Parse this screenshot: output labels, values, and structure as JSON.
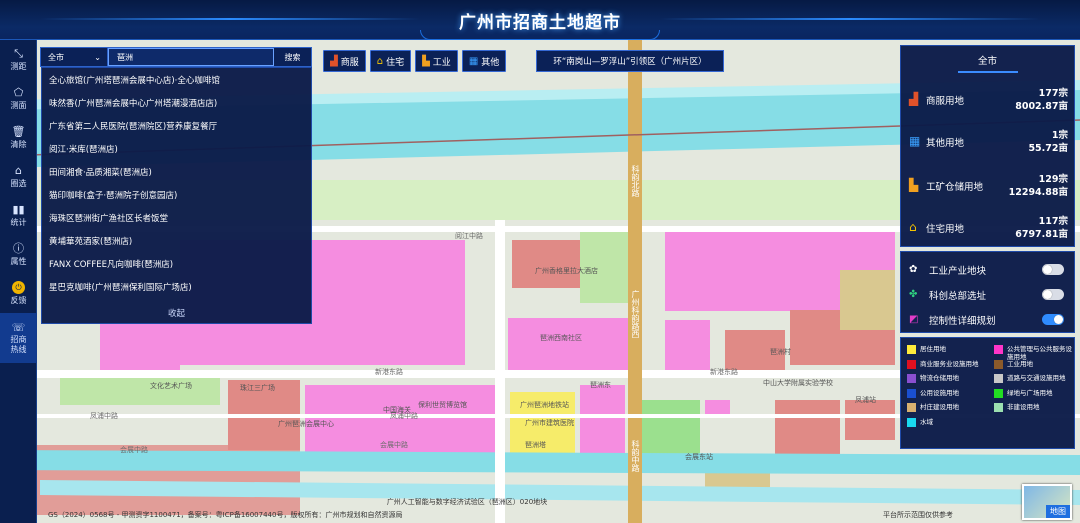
{
  "header": {
    "title": "广州市招商土地超市"
  },
  "toolbar": {
    "items": [
      {
        "label": "测距",
        "icon": "ruler-icon"
      },
      {
        "label": "测面",
        "icon": "polygon-icon"
      },
      {
        "label": "清除",
        "icon": "trash-icon"
      },
      {
        "label": "圈选",
        "icon": "circle-select-icon"
      },
      {
        "label": "统计",
        "icon": "bar-chart-icon"
      },
      {
        "label": "属性",
        "icon": "info-icon"
      },
      {
        "label": "反馈",
        "icon": "feedback-icon"
      },
      {
        "label": "招商热线",
        "icon": "phone-icon"
      }
    ]
  },
  "search": {
    "city": "全市",
    "query": "琶洲",
    "button": "搜索",
    "results": [
      "全心旅馆(广州塔琶洲会展中心店)·全心咖啡馆",
      "味然香(广州琶洲会展中心广州塔潮漫酒店店)",
      "广东省第二人民医院(琶洲院区)营养康复餐厅",
      "阅江·米库(琶洲店)",
      "田间湘食·品质湘菜(琶洲店)",
      "猫印咖啡(盒子·琶洲院子创意园店)",
      "海珠区琶洲街广渔社区长者饭堂",
      "黄埔華苑酒家(琶洲店)",
      "FANX COFFEE凡向咖啡(琶洲店)",
      "星巴克咖啡(广州琶洲保利国际广场店)"
    ],
    "collapse": "收起"
  },
  "categories": [
    {
      "label": "商服",
      "icon": "commerce-icon"
    },
    {
      "label": "住宅",
      "icon": "house-icon"
    },
    {
      "label": "工业",
      "icon": "factory-icon"
    },
    {
      "label": "其他",
      "icon": "other-icon"
    }
  ],
  "ring_button": "环“南岗山—罗浮山”引领区（广州片区）",
  "stats": {
    "tab": "全市",
    "rows": [
      {
        "name": "商服用地",
        "count": "177宗",
        "area": "8002.87亩",
        "color": "#e0522a",
        "icon": "commerce-icon"
      },
      {
        "name": "其他用地",
        "count": "1宗",
        "area": "55.72亩",
        "color": "#3aa0ff",
        "icon": "other-icon"
      },
      {
        "name": "工矿仓储用地",
        "count": "129宗",
        "area": "12294.88亩",
        "color": "#f0a020",
        "icon": "factory-icon"
      },
      {
        "name": "住宅用地",
        "count": "117宗",
        "area": "6797.81亩",
        "color": "#f5c400",
        "icon": "house-icon"
      }
    ]
  },
  "toggles": [
    {
      "label": "工业产业地块",
      "on": false,
      "icon": "industry-block-icon"
    },
    {
      "label": "科创总部选址",
      "on": false,
      "icon": "science-hq-icon"
    },
    {
      "label": "控制性详细规划",
      "on": true,
      "icon": "regulatory-plan-icon"
    }
  ],
  "legend": [
    {
      "label": "居住用地",
      "color": "#ffeb3b"
    },
    {
      "label": "公共管理与公共服务设施用地",
      "color": "#ff35c8"
    },
    {
      "label": "商业服务业设施用地",
      "color": "#e01020"
    },
    {
      "label": "工业用地",
      "color": "#8b5a2b"
    },
    {
      "label": "物流仓储用地",
      "color": "#8a4fd0"
    },
    {
      "label": "道路与交通设施用地",
      "color": "#c8c8c8"
    },
    {
      "label": "公用设施用地",
      "color": "#1a4fd0"
    },
    {
      "label": "绿地与广场用地",
      "color": "#22dd22"
    },
    {
      "label": "村庄建设用地",
      "color": "#d8b070"
    },
    {
      "label": "非建设用地",
      "color": "#9ce0b0"
    },
    {
      "label": "水域",
      "color": "#19d8f0"
    }
  ],
  "map": {
    "labels": [
      "阅江中路",
      "新港东路",
      "新港东路",
      "凤浦中路",
      "凤浦中路",
      "会展中路",
      "会展中路",
      "琶洲西南社区",
      "广州香格里拉大酒店",
      "琶洲村",
      "保利世贸博览馆",
      "广州琶洲会展中心",
      "珠江三广场",
      "文化艺术广场",
      "中国海关",
      "广州琶洲地铁站",
      "广州市建筑医院",
      "中山大学附属实验学校",
      "琶洲塔",
      "琶洲东",
      "凤浦站",
      "会展东站",
      "科韵中路",
      "科韵北路",
      "广州科韵路西"
    ]
  },
  "footer": {
    "left": "GS（2024）0568号 - 甲测资字1100471，备案号：粤ICP备16007440号，版权所有：广州市规划和自然资源局",
    "center": "广州人工智能与数字经济试验区（琶洲区）020地块",
    "right": "平台所示范围仅供参考",
    "basemap": "地图"
  }
}
